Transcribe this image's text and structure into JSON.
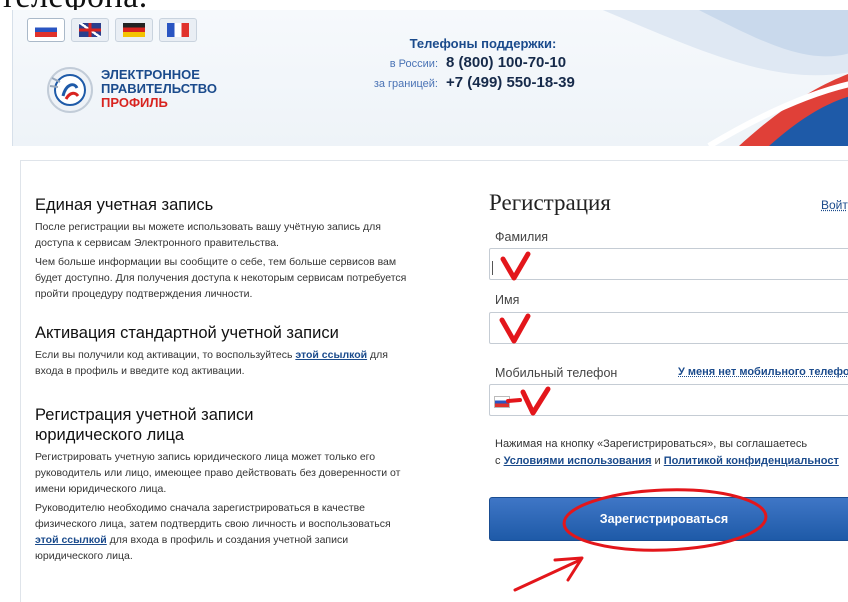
{
  "top_cut_text": "телефона.",
  "header": {
    "languages": [
      {
        "code": "ru",
        "icon": "flag-ru-icon",
        "active": true
      },
      {
        "code": "en",
        "icon": "flag-gb-icon",
        "active": false
      },
      {
        "code": "de",
        "icon": "flag-de-icon",
        "active": false
      },
      {
        "code": "fr",
        "icon": "flag-fr-icon",
        "active": false
      }
    ],
    "logo": {
      "line1": "ЭЛЕКТРОННОЕ",
      "line2": "ПРАВИТЕЛЬСТВО",
      "line3": "ПРОФИЛЬ"
    },
    "support": {
      "title": "Телефоны поддержки:",
      "russia_label": "в России:",
      "russia_phone": "8 (800) 100-70-10",
      "abroad_label": "за границей:",
      "abroad_phone": "+7 (499) 550-18-39"
    }
  },
  "left": {
    "s1": {
      "title": "Единая учетная запись",
      "p1": "После регистрации вы можете использовать вашу учётную запись для доступа к сервисам Электронного правительства.",
      "p2": "Чем больше информации вы сообщите о себе, тем больше сервисов вам будет доступно. Для получения доступа к некоторым сервисам потребуется пройти процедуру подтверждения личности."
    },
    "s2": {
      "title": "Активация стандартной учетной записи",
      "p_before": "Если вы получили код активации, то воспользуйтесь ",
      "link": "этой ссылкой",
      "p_after": " для входа в профиль и введите код активации."
    },
    "s3": {
      "title": "Регистрация учетной записи юридического лица",
      "p1": "Регистрировать учетную запись юридического лица может только его руководитель или лицо, имеющее право действовать без доверенности от имени юридического лица.",
      "p2_before": "Руководителю необходимо сначала зарегистрироваться в качестве физического лица, затем подтвердить свою личность и воспользоваться ",
      "link": "этой ссылкой",
      "p2_after": " для входа в профиль и создания учетной записи юридического лица."
    }
  },
  "form": {
    "title": "Регистрация",
    "login_link": "Войт",
    "surname_label": "Фамилия",
    "surname_value": "",
    "name_label": "Имя",
    "name_value": "",
    "mobile_label": "Мобильный телефон",
    "no_mobile_link": "У меня нет мобильного телефо",
    "mobile_value": "",
    "note_line1": "Нажимая на кнопку «Зарегистрироваться», вы соглашаетесь",
    "note_prefix": "с ",
    "terms_link": "Условиями использования",
    "note_and": " и ",
    "privacy_link": "Политикой конфиденциальност",
    "submit": "Зарегистрироваться"
  },
  "colors": {
    "annotation": "#e3161b",
    "brand": "#1b4b8c",
    "button": "#2a63b3"
  }
}
